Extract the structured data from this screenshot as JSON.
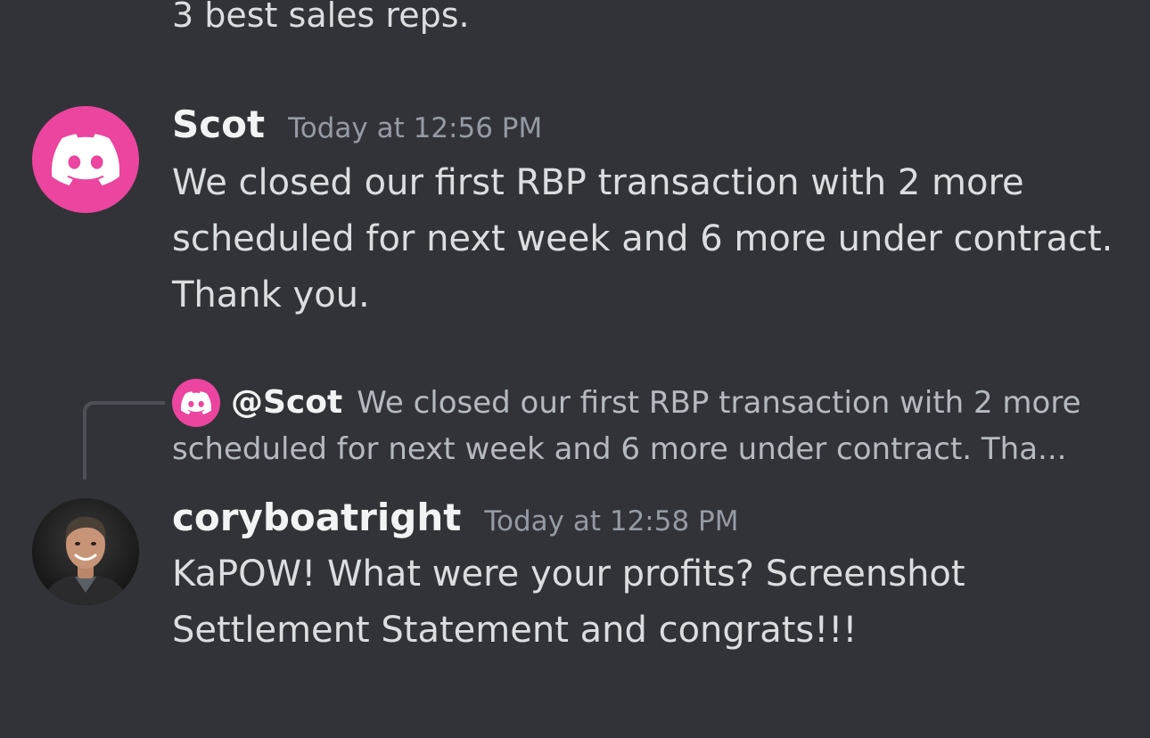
{
  "previous_message": {
    "text_fragment": "3 best sales reps."
  },
  "messages": [
    {
      "username": "Scot",
      "timestamp": "Today at 12:56 PM",
      "text": "We closed our first RBP transaction with 2 more scheduled for next week and 6 more under contract.  Thank you.",
      "avatar": "discord-logo-icon"
    },
    {
      "reply": {
        "mention": "@Scot",
        "preview_line1": "We closed our first RBP transaction with 2 more",
        "preview_line2": "scheduled for next week and 6 more under contract.  Tha..."
      },
      "username": "coryboatright",
      "timestamp": "Today at 12:58 PM",
      "text": "KaPOW! What were your profits? Screenshot Settlement Statement and congrats!!!",
      "avatar": "user-photo"
    }
  ],
  "colors": {
    "background": "#313338",
    "discord_pink": "#eb459f",
    "text": "#dbdee1",
    "username": "#f2f3f5",
    "timestamp": "#949ba4"
  }
}
